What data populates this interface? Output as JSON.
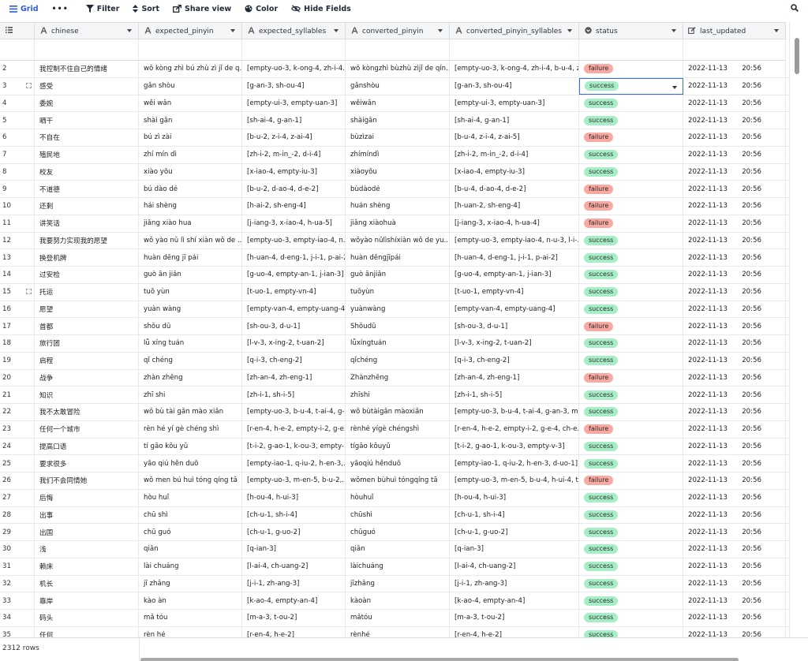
{
  "toolbar": {
    "grid": "Grid",
    "more": "•••",
    "filter": "Filter",
    "sort": "Sort",
    "share": "Share view",
    "color": "Color",
    "hide": "Hide Fields"
  },
  "colors": {
    "accent": "#2d5bd1",
    "success": "#a6eec6",
    "failure": "#f8a9a1",
    "active_border": "#3b6fd8"
  },
  "columns": [
    {
      "key": "chinese",
      "label": "chinese",
      "icon": "text-icon"
    },
    {
      "key": "expected_pinyin",
      "label": "expected_pinyin",
      "icon": "text-icon"
    },
    {
      "key": "expected_syllables",
      "label": "expected_syllables",
      "icon": "text-icon"
    },
    {
      "key": "converted_pinyin",
      "label": "converted_pinyin",
      "icon": "text-icon"
    },
    {
      "key": "converted_pinyin_syllables",
      "label": "converted_pinyin_syllables",
      "icon": "text-icon"
    },
    {
      "key": "status",
      "label": "status",
      "icon": "single-select-icon"
    },
    {
      "key": "last_updated",
      "label": "last_updated",
      "icon": "edit-icon"
    }
  ],
  "rows": [
    {
      "n": "2",
      "chinese": "我控制不住自己的情绪",
      "expected_pinyin": "wǒ kòng zhì bú zhù zì jǐ de q...",
      "expected_syllables": "[empty-uo-3, k-ong-4, zh-i-4...",
      "converted_pinyin": "wǒ kòngzhì bùzhù zìjǐ de qín...",
      "converted_syllables": "[empty-uo-3, k-ong-4, zh-i-4, b-u-4, z...",
      "status": "failure",
      "date": "2022-11-13",
      "time": "20:56"
    },
    {
      "n": "3",
      "chinese": "感受",
      "expected_pinyin": "gǎn shòu",
      "expected_syllables": "[g-an-3, sh-ou-4]",
      "converted_pinyin": "gǎnshòu",
      "converted_syllables": "[g-an-3, sh-ou-4]",
      "status": "success",
      "date": "2022-11-13",
      "time": "20:56"
    },
    {
      "n": "4",
      "chinese": "委婉",
      "expected_pinyin": "wěi wǎn",
      "expected_syllables": "[empty-ui-3, empty-uan-3]",
      "converted_pinyin": "wěiwǎn",
      "converted_syllables": "[empty-ui-3, empty-uan-3]",
      "status": "success",
      "date": "2022-11-13",
      "time": "20:56"
    },
    {
      "n": "5",
      "chinese": "晒干",
      "expected_pinyin": "shài gān",
      "expected_syllables": "[sh-ai-4, g-an-1]",
      "converted_pinyin": "shàigān",
      "converted_syllables": "[sh-ai-4, g-an-1]",
      "status": "success",
      "date": "2022-11-13",
      "time": "20:56"
    },
    {
      "n": "6",
      "chinese": "不自在",
      "expected_pinyin": "bú zì zài",
      "expected_syllables": "[b-u-2, z-i-4, z-ai-4]",
      "converted_pinyin": "bùzìzai",
      "converted_syllables": "[b-u-4, z-i-4, z-ai-5]",
      "status": "failure",
      "date": "2022-11-13",
      "time": "20:56"
    },
    {
      "n": "7",
      "chinese": "殖民地",
      "expected_pinyin": "zhí mín dì",
      "expected_syllables": "[zh-i-2, m-in_-2, d-i-4]",
      "converted_pinyin": "zhímíndì",
      "converted_syllables": "[zh-i-2, m-in_-2, d-i-4]",
      "status": "success",
      "date": "2022-11-13",
      "time": "20:56"
    },
    {
      "n": "8",
      "chinese": "校友",
      "expected_pinyin": "xiào yǒu",
      "expected_syllables": "[x-iao-4, empty-iu-3]",
      "converted_pinyin": "xiàoyǒu",
      "converted_syllables": "[x-iao-4, empty-iu-3]",
      "status": "success",
      "date": "2022-11-13",
      "time": "20:56"
    },
    {
      "n": "9",
      "chinese": "不道德",
      "expected_pinyin": "bú dào dé",
      "expected_syllables": "[b-u-2, d-ao-4, d-e-2]",
      "converted_pinyin": "bùdàodé",
      "converted_syllables": "[b-u-4, d-ao-4, d-e-2]",
      "status": "failure",
      "date": "2022-11-13",
      "time": "20:56"
    },
    {
      "n": "10",
      "chinese": "还剩",
      "expected_pinyin": "hái shèng",
      "expected_syllables": "[h-ai-2, sh-eng-4]",
      "converted_pinyin": "huán shèng",
      "converted_syllables": "[h-uan-2, sh-eng-4]",
      "status": "failure",
      "date": "2022-11-13",
      "time": "20:56"
    },
    {
      "n": "11",
      "chinese": "讲笑话",
      "expected_pinyin": "jiǎng xiào hua",
      "expected_syllables": "[j-iang-3, x-iao-4, h-ua-5]",
      "converted_pinyin": "jiǎng xiàohuà",
      "converted_syllables": "[j-iang-3, x-iao-4, h-ua-4]",
      "status": "failure",
      "date": "2022-11-13",
      "time": "20:56"
    },
    {
      "n": "12",
      "chinese": "我要努力实现我的愿望",
      "expected_pinyin": "wǒ yào nǔ lì shí xiàn wǒ de ...",
      "expected_syllables": "[empty-uo-3, empty-iao-4, n...",
      "converted_pinyin": "wǒyào nǔlìshíxiàn wǒ de yu...",
      "converted_syllables": "[empty-uo-3, empty-iao-4, n-u-3, l-i-...",
      "status": "success",
      "date": "2022-11-13",
      "time": "20:56"
    },
    {
      "n": "13",
      "chinese": "换登机牌",
      "expected_pinyin": "huàn dēng jī pái",
      "expected_syllables": "[h-uan-4, d-eng-1, j-i-1, p-ai-2]",
      "converted_pinyin": "huàn dēngjīpái",
      "converted_syllables": "[h-uan-4, d-eng-1, j-i-1, p-ai-2]",
      "status": "success",
      "date": "2022-11-13",
      "time": "20:56"
    },
    {
      "n": "14",
      "chinese": "过安检",
      "expected_pinyin": "guò ān jiǎn",
      "expected_syllables": "[g-uo-4, empty-an-1, j-ian-3]",
      "converted_pinyin": "guò ānjiǎn",
      "converted_syllables": "[g-uo-4, empty-an-1, j-ian-3]",
      "status": "success",
      "date": "2022-11-13",
      "time": "20:56"
    },
    {
      "n": "15",
      "chinese": "托运",
      "expected_pinyin": "tuō yùn",
      "expected_syllables": "[t-uo-1, empty-vn-4]",
      "converted_pinyin": "tuōyùn",
      "converted_syllables": "[t-uo-1, empty-vn-4]",
      "status": "success",
      "date": "2022-11-13",
      "time": "20:56"
    },
    {
      "n": "16",
      "chinese": "愿望",
      "expected_pinyin": "yuàn wàng",
      "expected_syllables": "[empty-van-4, empty-uang-4]",
      "converted_pinyin": "yuànwàng",
      "converted_syllables": "[empty-van-4, empty-uang-4]",
      "status": "success",
      "date": "2022-11-13",
      "time": "20:56"
    },
    {
      "n": "17",
      "chinese": "首都",
      "expected_pinyin": "shǒu dū",
      "expected_syllables": "[sh-ou-3, d-u-1]",
      "converted_pinyin": "Shǒudū",
      "converted_syllables": "[sh-ou-3, d-u-1]",
      "status": "failure",
      "date": "2022-11-13",
      "time": "20:56"
    },
    {
      "n": "18",
      "chinese": "旅行团",
      "expected_pinyin": "lǚ xíng tuán",
      "expected_syllables": "[l-v-3, x-ing-2, t-uan-2]",
      "converted_pinyin": "lǚxíngtuán",
      "converted_syllables": "[l-v-3, x-ing-2, t-uan-2]",
      "status": "success",
      "date": "2022-11-13",
      "time": "20:56"
    },
    {
      "n": "19",
      "chinese": "启程",
      "expected_pinyin": "qǐ chéng",
      "expected_syllables": "[q-i-3, ch-eng-2]",
      "converted_pinyin": "qǐchéng",
      "converted_syllables": "[q-i-3, ch-eng-2]",
      "status": "success",
      "date": "2022-11-13",
      "time": "20:56"
    },
    {
      "n": "20",
      "chinese": "战争",
      "expected_pinyin": "zhàn zhēng",
      "expected_syllables": "[zh-an-4, zh-eng-1]",
      "converted_pinyin": "Zhànzhēng",
      "converted_syllables": "[zh-an-4, zh-eng-1]",
      "status": "failure",
      "date": "2022-11-13",
      "time": "20:56"
    },
    {
      "n": "21",
      "chinese": "知识",
      "expected_pinyin": "zhī shi",
      "expected_syllables": "[zh-i-1, sh-i-5]",
      "converted_pinyin": "zhīshi",
      "converted_syllables": "[zh-i-1, sh-i-5]",
      "status": "success",
      "date": "2022-11-13",
      "time": "20:56"
    },
    {
      "n": "22",
      "chinese": "我不太敢冒险",
      "expected_pinyin": "wǒ bù tài gǎn mào xiǎn",
      "expected_syllables": "[empty-uo-3, b-u-4, t-ai-4, g-...",
      "converted_pinyin": "wǒ bùtàigǎn màoxiǎn",
      "converted_syllables": "[empty-uo-3, b-u-4, t-ai-4, g-an-3, m-...",
      "status": "success",
      "date": "2022-11-13",
      "time": "20:56"
    },
    {
      "n": "23",
      "chinese": "任何一个城市",
      "expected_pinyin": "rèn hé yí gè chéng shì",
      "expected_syllables": "[r-en-4, h-e-2, empty-i-2, g-e...",
      "converted_pinyin": "rènhé yígè chéngshì",
      "converted_syllables": "[r-en-4, h-e-2, empty-i-2, g-e-4, ch-e...",
      "status": "failure",
      "date": "2022-11-13",
      "time": "20:56"
    },
    {
      "n": "24",
      "chinese": "提高口语",
      "expected_pinyin": "tí gāo kǒu yǔ",
      "expected_syllables": "[t-i-2, g-ao-1, k-ou-3, empty-...",
      "converted_pinyin": "tígāo kǒuyǔ",
      "converted_syllables": "[t-i-2, g-ao-1, k-ou-3, empty-v-3]",
      "status": "success",
      "date": "2022-11-13",
      "time": "20:56"
    },
    {
      "n": "25",
      "chinese": "要求很多",
      "expected_pinyin": "yāo qiú hěn duō",
      "expected_syllables": "[empty-iao-1, q-iu-2, h-en-3,...",
      "converted_pinyin": "yāoqiú hěnduō",
      "converted_syllables": "[empty-iao-1, q-iu-2, h-en-3, d-uo-1]",
      "status": "success",
      "date": "2022-11-13",
      "time": "20:56"
    },
    {
      "n": "26",
      "chinese": "我们不会同情她",
      "expected_pinyin": "wǒ men bú huì tóng qíng tā",
      "expected_syllables": "[empty-uo-3, m-en-5, b-u-2,...",
      "converted_pinyin": "wǒmen bùhuì tóngqíng tā",
      "converted_syllables": "[empty-uo-3, m-en-5, b-u-4, h-ui-4, t...",
      "status": "failure",
      "date": "2022-11-13",
      "time": "20:56"
    },
    {
      "n": "27",
      "chinese": "后悔",
      "expected_pinyin": "hòu huǐ",
      "expected_syllables": "[h-ou-4, h-ui-3]",
      "converted_pinyin": "hòuhuǐ",
      "converted_syllables": "[h-ou-4, h-ui-3]",
      "status": "success",
      "date": "2022-11-13",
      "time": "20:56"
    },
    {
      "n": "28",
      "chinese": "出事",
      "expected_pinyin": "chū shì",
      "expected_syllables": "[ch-u-1, sh-i-4]",
      "converted_pinyin": "chūshì",
      "converted_syllables": "[ch-u-1, sh-i-4]",
      "status": "success",
      "date": "2022-11-13",
      "time": "20:56"
    },
    {
      "n": "29",
      "chinese": "出国",
      "expected_pinyin": "chū guó",
      "expected_syllables": "[ch-u-1, g-uo-2]",
      "converted_pinyin": "chūguó",
      "converted_syllables": "[ch-u-1, g-uo-2]",
      "status": "success",
      "date": "2022-11-13",
      "time": "20:56"
    },
    {
      "n": "30",
      "chinese": "浅",
      "expected_pinyin": "qiǎn",
      "expected_syllables": "[q-ian-3]",
      "converted_pinyin": "qiǎn",
      "converted_syllables": "[q-ian-3]",
      "status": "success",
      "date": "2022-11-13",
      "time": "20:56"
    },
    {
      "n": "31",
      "chinese": "赖床",
      "expected_pinyin": "lài chuáng",
      "expected_syllables": "[l-ai-4, ch-uang-2]",
      "converted_pinyin": "làichuáng",
      "converted_syllables": "[l-ai-4, ch-uang-2]",
      "status": "success",
      "date": "2022-11-13",
      "time": "20:56"
    },
    {
      "n": "32",
      "chinese": "机长",
      "expected_pinyin": "jī zhǎng",
      "expected_syllables": "[j-i-1, zh-ang-3]",
      "converted_pinyin": "jīzhǎng",
      "converted_syllables": "[j-i-1, zh-ang-3]",
      "status": "success",
      "date": "2022-11-13",
      "time": "20:56"
    },
    {
      "n": "33",
      "chinese": "靠岸",
      "expected_pinyin": "kào àn",
      "expected_syllables": "[k-ao-4, empty-an-4]",
      "converted_pinyin": "kàoàn",
      "converted_syllables": "[k-ao-4, empty-an-4]",
      "status": "success",
      "date": "2022-11-13",
      "time": "20:56"
    },
    {
      "n": "34",
      "chinese": "码头",
      "expected_pinyin": "mǎ tóu",
      "expected_syllables": "[m-a-3, t-ou-2]",
      "converted_pinyin": "mǎtóu",
      "converted_syllables": "[m-a-3, t-ou-2]",
      "status": "success",
      "date": "2022-11-13",
      "time": "20:56"
    },
    {
      "n": "35",
      "chinese": "任何",
      "expected_pinyin": "rèn hé",
      "expected_syllables": "[r-en-4, h-e-2]",
      "converted_pinyin": "rènhé",
      "converted_syllables": "[r-en-4, h-e-2]",
      "status": "success",
      "date": "2022-11-13",
      "time": "20:56"
    }
  ],
  "footer": {
    "row_count": "2312 rows"
  }
}
